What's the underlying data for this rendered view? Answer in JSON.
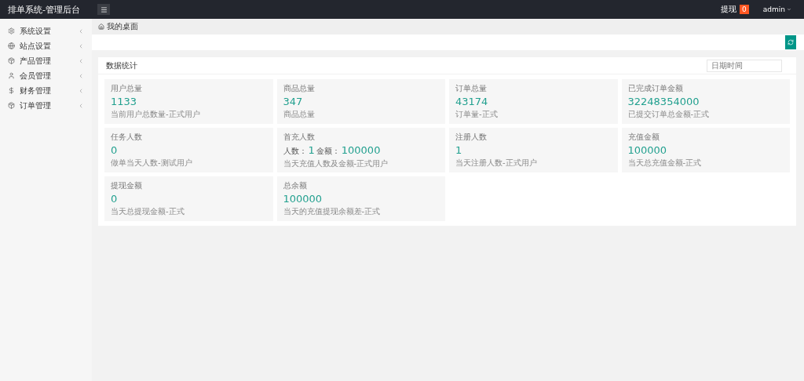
{
  "header": {
    "title": "排单系统-管理后台",
    "withdraw_label": "提现",
    "withdraw_count": "0",
    "user": "admin"
  },
  "sidebar": {
    "items": [
      {
        "label": "系统设置",
        "expanded": false
      },
      {
        "label": "站点设置",
        "expanded": false
      },
      {
        "label": "产品管理",
        "expanded": false
      },
      {
        "label": "会员管理",
        "expanded": false
      },
      {
        "label": "财务管理",
        "expanded": false
      },
      {
        "label": "订单管理",
        "expanded": false
      }
    ]
  },
  "breadcrumb": {
    "label": "我的桌面"
  },
  "panel": {
    "title": "数据统计",
    "date_placeholder": "日期时间",
    "stats": [
      {
        "kind": "single",
        "label": "用户总量",
        "value": "1133",
        "note": "当前用户总数量-正式用户"
      },
      {
        "kind": "single",
        "label": "商品总量",
        "value": "347",
        "note": "商品总量"
      },
      {
        "kind": "single",
        "label": "订单总量",
        "value": "43174",
        "note": "订单量-正式"
      },
      {
        "kind": "single",
        "label": "已完成订单金额",
        "value": "32248354000",
        "note": "已提交订单总金额-正式"
      },
      {
        "kind": "single",
        "label": "任务人数",
        "value": "0",
        "note": "做单当天人数-测试用户"
      },
      {
        "kind": "pair",
        "label": "首充人数",
        "count_label": "人数：",
        "value": "1",
        "amount_label": "金额：",
        "amount": "100000",
        "note": "当天充值人数及金额-正式用户"
      },
      {
        "kind": "single",
        "label": "注册人数",
        "value": "1",
        "note": "当天注册人数-正式用户"
      },
      {
        "kind": "single",
        "label": "充值金额",
        "value": "100000",
        "note": "当天总充值金额-正式"
      },
      {
        "kind": "single",
        "label": "提现金额",
        "value": "0",
        "note": "当天总提现金额-正式"
      },
      {
        "kind": "single",
        "label": "总余额",
        "value": "100000",
        "note": "当天的充值提现余额差-正式"
      }
    ]
  }
}
